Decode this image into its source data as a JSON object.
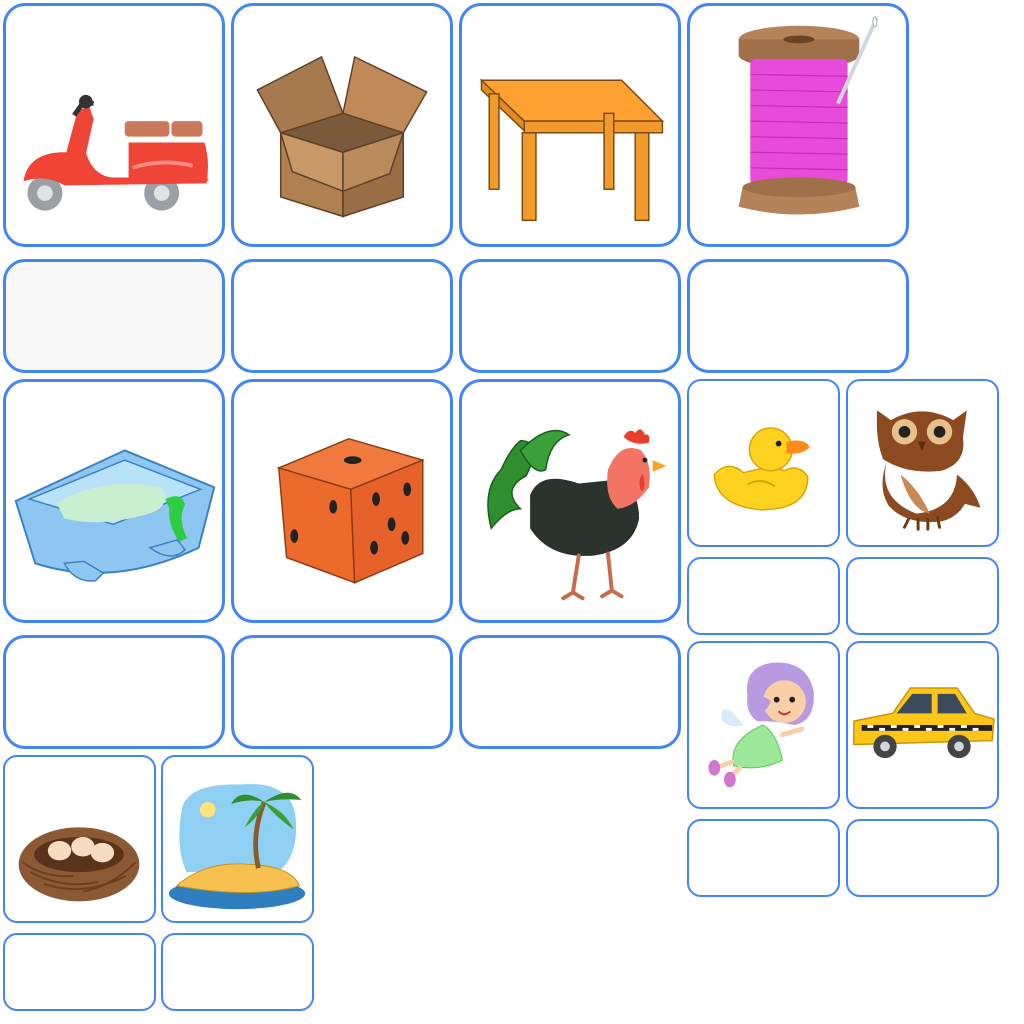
{
  "worksheet": {
    "accent_color": "#4285f4",
    "answer_values": {
      "scooter": "",
      "box": "",
      "table": "",
      "spool": "",
      "cradle": "",
      "die": "",
      "rooster": "",
      "duck": "",
      "owl": "",
      "fairy": "",
      "taxi": "",
      "nest": "",
      "island": ""
    },
    "pictures": [
      "scooter-icon",
      "box-icon",
      "table-icon",
      "spool-icon",
      "cradle-icon",
      "die-icon",
      "rooster-icon",
      "duck-icon",
      "owl-icon",
      "fairy-icon",
      "taxi-icon",
      "nest-icon",
      "island-icon"
    ]
  }
}
